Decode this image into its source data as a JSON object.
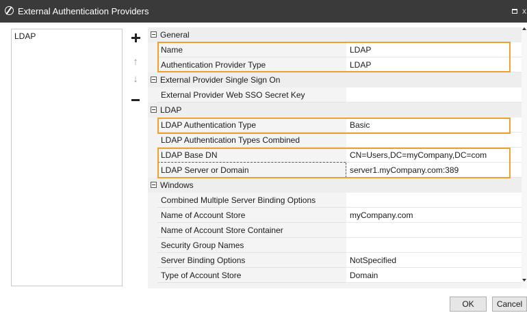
{
  "window": {
    "title": "External Authentication Providers",
    "icon": "slash-circle-icon",
    "close_glyph": "x"
  },
  "providers": [
    "LDAP"
  ],
  "toolbar": [
    "add-icon",
    "move-up-icon",
    "move-down-icon",
    "remove-icon"
  ],
  "categories": {
    "general": {
      "label": "General",
      "props": [
        {
          "name": "Name",
          "value": "LDAP"
        },
        {
          "name": "Authentication Provider Type",
          "value": "LDAP"
        }
      ]
    },
    "sso": {
      "label": "External Provider Single Sign On",
      "props": [
        {
          "name": "External Provider Web SSO Secret Key",
          "value": ""
        }
      ]
    },
    "ldap": {
      "label": "LDAP",
      "props": [
        {
          "name": "LDAP Authentication Type",
          "value": "Basic"
        },
        {
          "name": "LDAP Authentication Types Combined",
          "value": ""
        },
        {
          "name": "LDAP Base DN",
          "value": "CN=Users,DC=myCompany,DC=com"
        },
        {
          "name": "LDAP Server or Domain",
          "value": "server1.myCompany.com:389"
        }
      ]
    },
    "windows": {
      "label": "Windows",
      "props": [
        {
          "name": "Combined Multiple Server Binding Options",
          "value": ""
        },
        {
          "name": "Name of Account Store",
          "value": "myCompany.com"
        },
        {
          "name": "Name of Account Store Container",
          "value": ""
        },
        {
          "name": "Security Group Names",
          "value": ""
        },
        {
          "name": "Server Binding Options",
          "value": "NotSpecified"
        },
        {
          "name": "Type of Account Store",
          "value": "Domain"
        }
      ]
    }
  },
  "footer": {
    "ok_label": "OK",
    "cancel_label": "Cancel"
  },
  "colors": {
    "titlebar": "#3a3a3a",
    "highlight": "#f0a030"
  }
}
